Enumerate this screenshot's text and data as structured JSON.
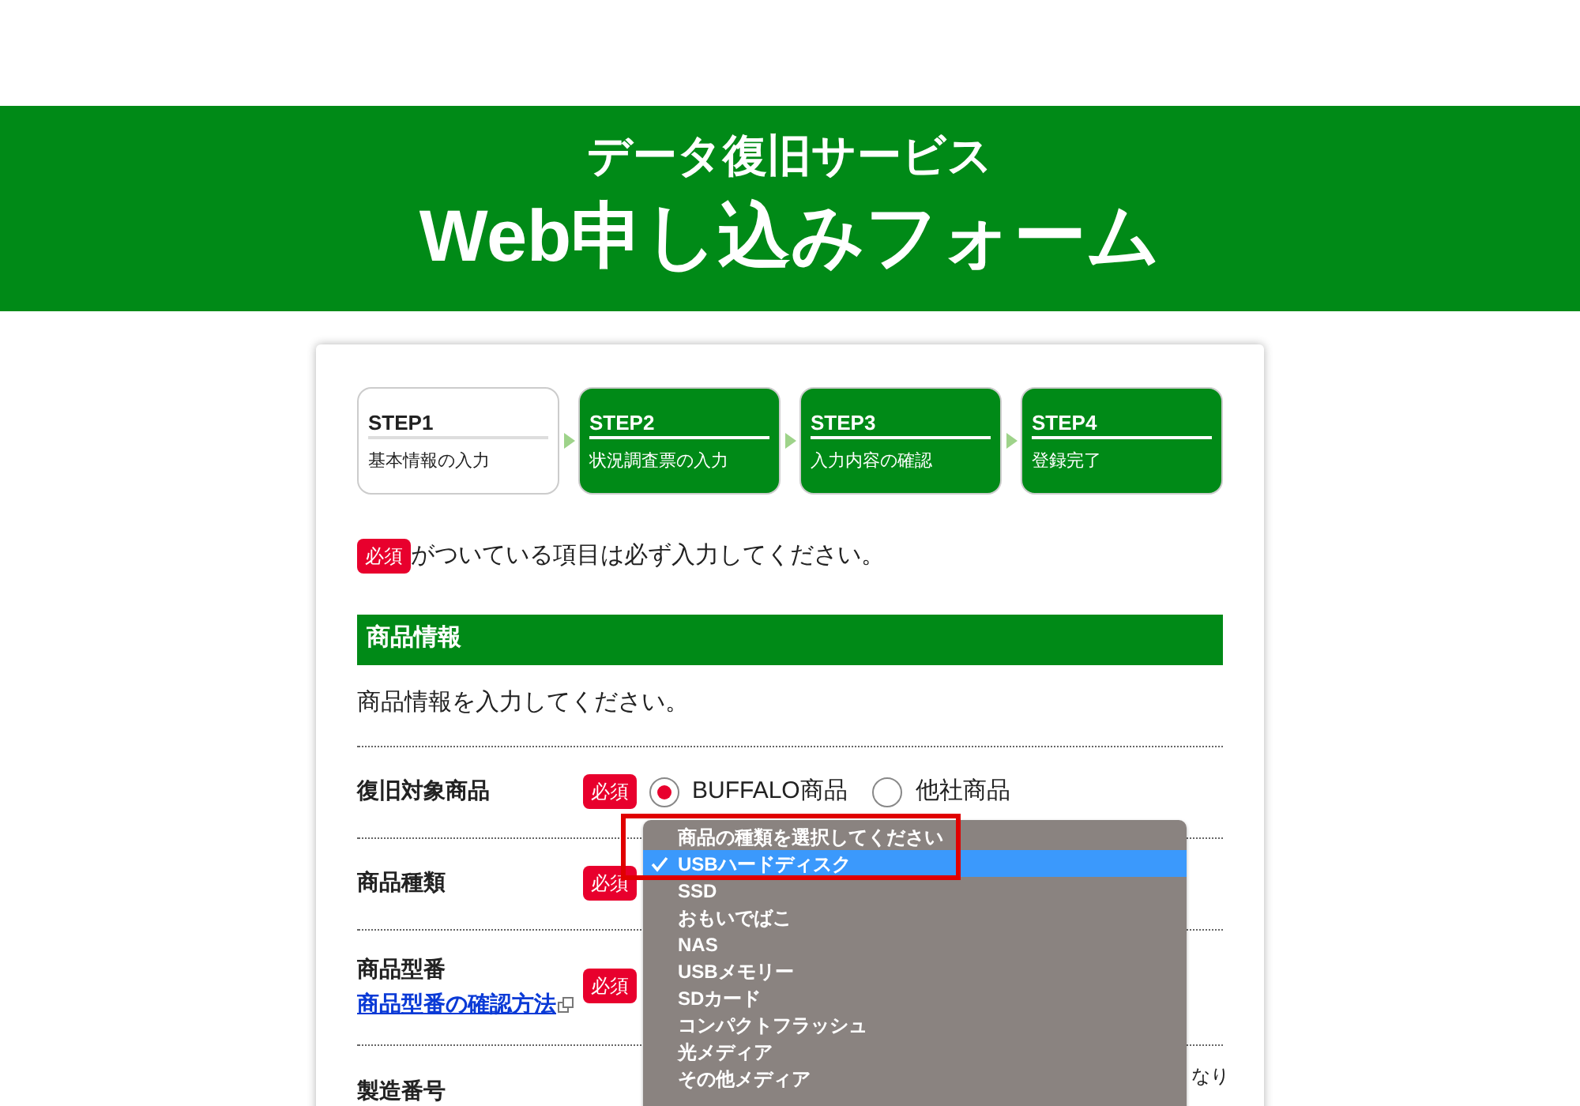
{
  "header": {
    "subtitle": "データ復旧サービス",
    "title": "Web申し込みフォーム"
  },
  "steps": [
    {
      "label": "STEP1",
      "text": "基本情報の入力",
      "selected": true
    },
    {
      "label": "STEP2",
      "text": "状況調査票の入力",
      "selected": false
    },
    {
      "label": "STEP3",
      "text": "入力内容の確認",
      "selected": false
    },
    {
      "label": "STEP4",
      "text": "登録完了",
      "selected": false
    }
  ],
  "required_note": {
    "badge": "必須",
    "text": "がついている項目は必ず入力してください。"
  },
  "section": {
    "title": "商品情報",
    "description": "商品情報を入力してください。"
  },
  "fields": [
    {
      "kind": "radio",
      "label": "復旧対象商品",
      "badge": "必須",
      "options": [
        {
          "label": "BUFFALO商品",
          "selected": true
        },
        {
          "label": "他社商品",
          "selected": false
        }
      ]
    },
    {
      "kind": "select",
      "label": "商品種類",
      "badge": "必須"
    },
    {
      "kind": "text",
      "label": "商品型番",
      "link": "商品型番の確認方法",
      "badge": "必須"
    },
    {
      "kind": "text",
      "label": "製造番号",
      "note": "なり"
    }
  ],
  "dropdown": {
    "options": [
      {
        "label": "商品の種類を選択してください",
        "selected": false
      },
      {
        "label": "USBハードディスク",
        "selected": true
      },
      {
        "label": "SSD",
        "selected": false
      },
      {
        "label": "おもいでばこ",
        "selected": false
      },
      {
        "label": "NAS",
        "selected": false
      },
      {
        "label": "USBメモリー",
        "selected": false
      },
      {
        "label": "SDカード",
        "selected": false
      },
      {
        "label": "コンパクトフラッシュ",
        "selected": false
      },
      {
        "label": "光メディア",
        "selected": false
      },
      {
        "label": "その他メディア",
        "selected": false
      }
    ]
  }
}
